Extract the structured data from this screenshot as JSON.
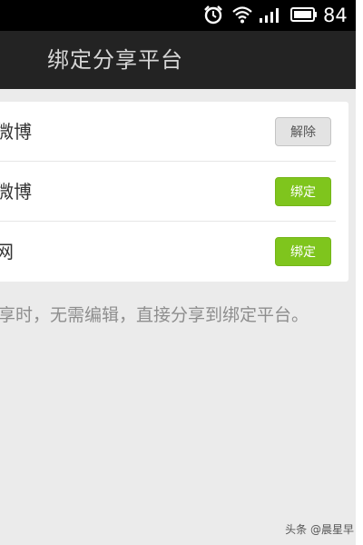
{
  "status_bar": {
    "battery": "84",
    "icons": [
      "alarm-icon",
      "wifi-icon",
      "signal-icon",
      "battery-icon"
    ]
  },
  "header": {
    "title": "绑定分享平台"
  },
  "platforms": [
    {
      "label": "微博",
      "button": "解除",
      "state": "bound"
    },
    {
      "label": "微博",
      "button": "绑定",
      "state": "unbound"
    },
    {
      "label": "网",
      "button": "绑定",
      "state": "unbound"
    }
  ],
  "hint": "享时，无需编辑，直接分享到绑定平台。",
  "watermark": "头条 @晨星早",
  "colors": {
    "accent_green": "#7fc51d",
    "title_bar": "#232323",
    "background": "#ebebeb"
  }
}
